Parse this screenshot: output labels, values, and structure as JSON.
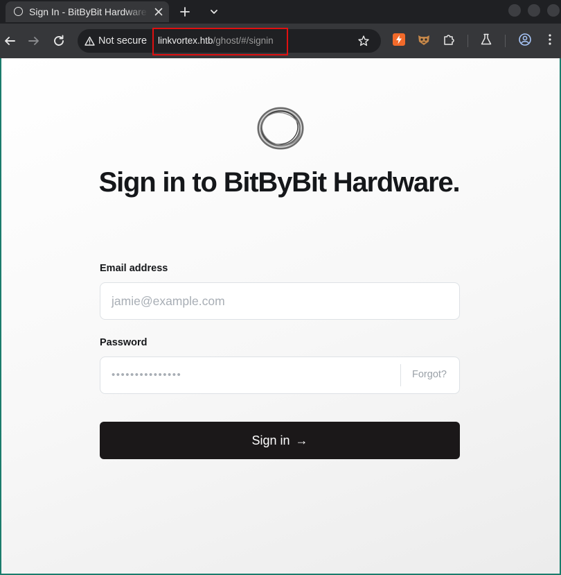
{
  "browser": {
    "tab_title": "Sign In - BitByBit Hardware",
    "address": {
      "security_label": "Not secure",
      "host": "linkvortex.htb",
      "path": "/ghost/#/signin"
    }
  },
  "icons": {
    "tab_favicon": "circle-icon",
    "tab_close": "close-icon",
    "new_tab": "plus-icon",
    "tab_search": "chevron-down-icon",
    "back": "arrow-left-icon",
    "forward": "arrow-right-icon",
    "reload": "reload-icon",
    "warning": "warning-triangle-icon",
    "bookmark": "star-icon",
    "extensions": [
      "bolt-extension-icon",
      "fox-extension-icon",
      "puzzle-icon",
      "flask-icon"
    ],
    "profile": "profile-icon",
    "menu": "kebab-menu-icon"
  },
  "colors": {
    "url_highlight": "#e01010",
    "signin_button": "#1b1819",
    "page_background": "#f7f7f7"
  },
  "signin": {
    "heading": "Sign in to BitByBit Hardware.",
    "email_label": "Email address",
    "email_placeholder": "jamie@example.com",
    "password_label": "Password",
    "password_mask": "•••••••••••••••",
    "forgot_label": "Forgot?",
    "button_label": "Sign in",
    "button_arrow": "→"
  }
}
